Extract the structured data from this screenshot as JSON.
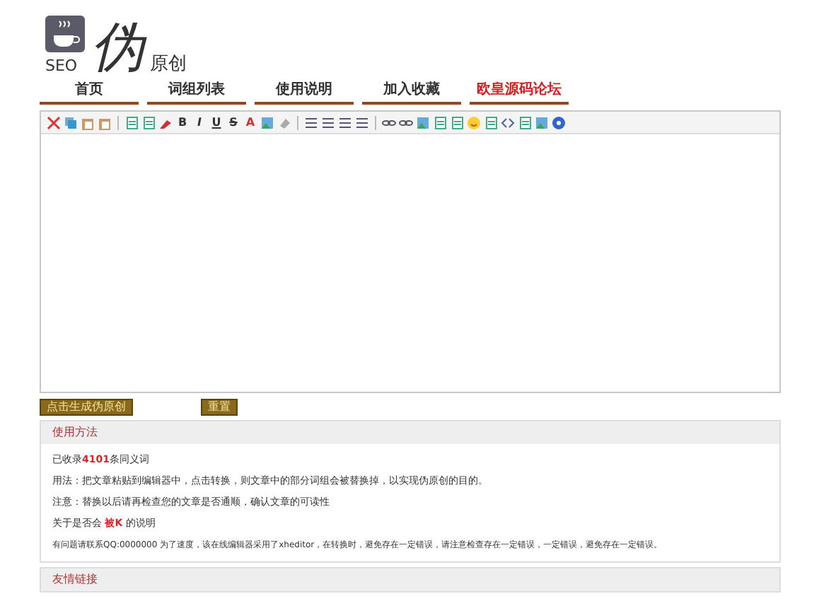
{
  "logo": {
    "tag": "SEO",
    "title": "伪",
    "subtitle": "原创"
  },
  "nav": [
    {
      "label": "首页",
      "highlight": false
    },
    {
      "label": "词组列表",
      "highlight": false
    },
    {
      "label": "使用说明",
      "highlight": false
    },
    {
      "label": "加入收藏",
      "highlight": false
    },
    {
      "label": "欧皇源码论坛",
      "highlight": true
    }
  ],
  "toolbar": [
    {
      "kind": "cut"
    },
    {
      "kind": "copy"
    },
    {
      "kind": "paste"
    },
    {
      "kind": "paste"
    },
    {
      "kind": "sep"
    },
    {
      "kind": "doc"
    },
    {
      "kind": "doc"
    },
    {
      "kind": "brush"
    },
    {
      "kind": "glyph",
      "text": "B"
    },
    {
      "kind": "glyph",
      "text": "I"
    },
    {
      "kind": "glyph",
      "text": "U"
    },
    {
      "kind": "glyph",
      "text": "S"
    },
    {
      "kind": "glyph",
      "text": "A"
    },
    {
      "kind": "image"
    },
    {
      "kind": "eraser"
    },
    {
      "kind": "sep"
    },
    {
      "kind": "list"
    },
    {
      "kind": "list"
    },
    {
      "kind": "list"
    },
    {
      "kind": "list"
    },
    {
      "kind": "sep"
    },
    {
      "kind": "link"
    },
    {
      "kind": "link"
    },
    {
      "kind": "image"
    },
    {
      "kind": "doc"
    },
    {
      "kind": "doc"
    },
    {
      "kind": "smile"
    },
    {
      "kind": "doc"
    },
    {
      "kind": "code"
    },
    {
      "kind": "doc"
    },
    {
      "kind": "image"
    },
    {
      "kind": "help"
    }
  ],
  "buttons": [
    "点击生成伪原创",
    "重置"
  ],
  "usage": {
    "title": "使用方法",
    "lines": [
      "已收录**4101**条同义词",
      "用法：把文章粘贴到编辑器中，点击转换，则文章中的部分词组会被替换掉，以实现伪原创的目的。",
      "注意：替换以后请再检查您的文章是否通顺，确认文章的可读性",
      "关于是否会 **被K** 的说明",
      "有问题请联系QQ:0000000 为了速度，该在线编辑器采用了xheditor，在转换时，避免存在一定错误，请注意检查存在一定错误，一定错误，避免存在一定错误。"
    ]
  },
  "links": {
    "title": "友情链接"
  }
}
